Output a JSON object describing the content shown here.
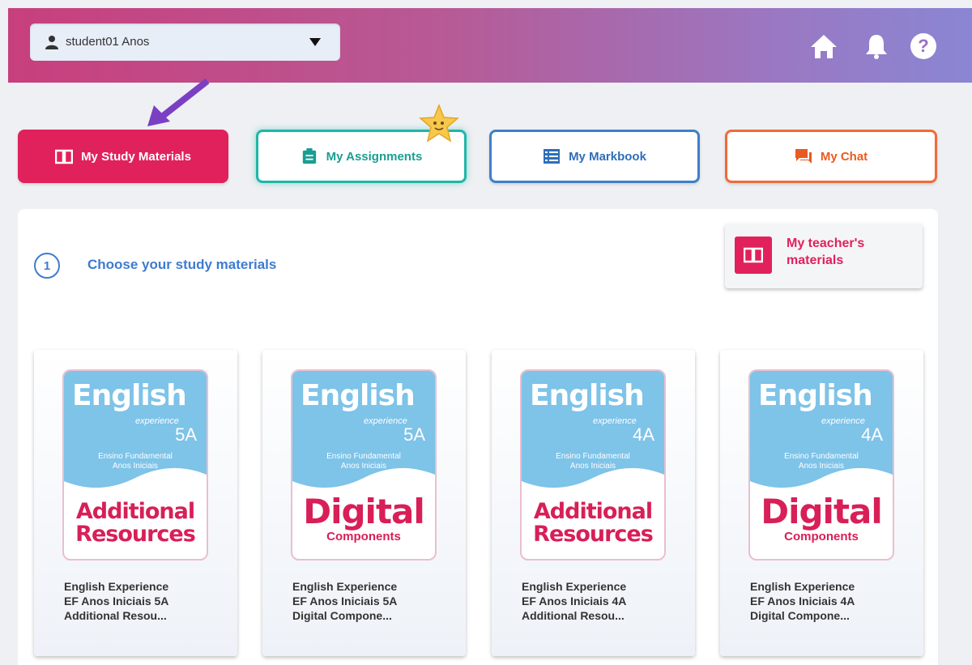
{
  "header": {
    "user_name": "student01 Anos",
    "icons": [
      "home-icon",
      "bell-icon",
      "help-icon"
    ],
    "gradient": [
      "#c83f7d",
      "#8a86d3"
    ]
  },
  "nav": {
    "study_label": "My Study Materials",
    "assignments_label": "My Assignments",
    "markbook_label": "My Markbook",
    "chat_label": "My Chat"
  },
  "main": {
    "step_number": "1",
    "step_label": "Choose your study materials",
    "teacher_materials_label": "My teacher's materials"
  },
  "cards": [
    {
      "brand": "English",
      "brand_sub": "experience",
      "level": "5A",
      "ensino": "Ensino Fundamental",
      "anos": "Anos Iniciais",
      "big": "Additional",
      "big2": "Resources",
      "title_lines": [
        "English Experience",
        "EF Anos Iniciais 5A",
        "Additional Resou..."
      ]
    },
    {
      "brand": "English",
      "brand_sub": "experience",
      "level": "5A",
      "ensino": "Ensino Fundamental",
      "anos": "Anos Iniciais",
      "big": "Digital",
      "big2": "Components",
      "title_lines": [
        "English Experience",
        "EF Anos Iniciais 5A",
        "Digital Compone..."
      ]
    },
    {
      "brand": "English",
      "brand_sub": "experience",
      "level": "4A",
      "ensino": "Ensino Fundamental",
      "anos": "Anos Iniciais",
      "big": "Additional",
      "big2": "Resources",
      "title_lines": [
        "English Experience",
        "EF Anos Iniciais 4A",
        "Additional Resou..."
      ]
    },
    {
      "brand": "English",
      "brand_sub": "experience",
      "level": "4A",
      "ensino": "Ensino Fundamental",
      "anos": "Anos Iniciais",
      "big": "Digital",
      "big2": "Components",
      "title_lines": [
        "English Experience",
        "EF Anos Iniciais 4A",
        "Digital Compone..."
      ]
    }
  ],
  "colors": {
    "accent_pink": "#e1215c",
    "teal": "#1fb6a8",
    "blue": "#3f7fc8",
    "orange": "#ee6b3b",
    "arrow_purple": "#7b3fc4",
    "cover_blue": "#7ec3e8"
  }
}
